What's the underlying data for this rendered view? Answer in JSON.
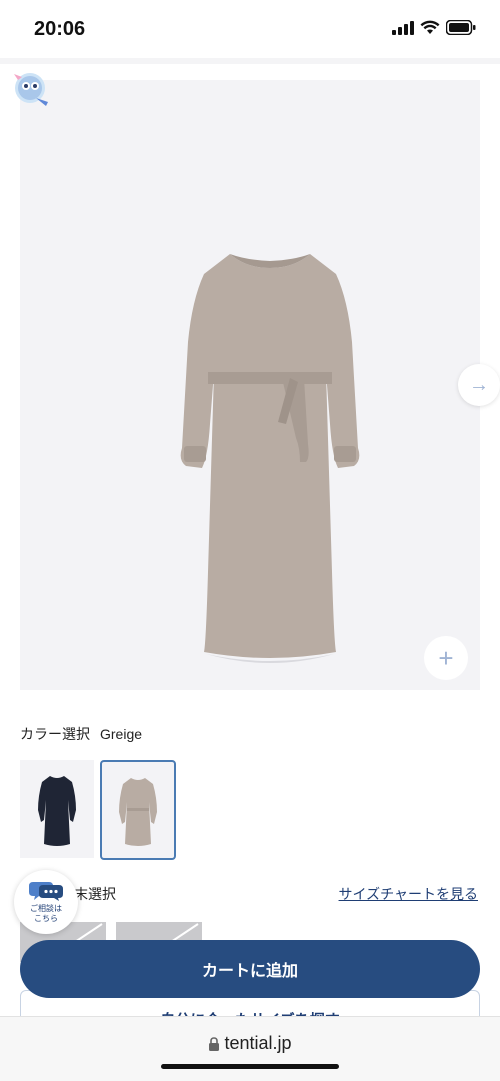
{
  "status_bar": {
    "time": "20:06"
  },
  "product": {
    "color_heading": "カラー選択",
    "color_value": "Greige",
    "swatches": [
      {
        "name": "Navy",
        "color": "#1f2535"
      },
      {
        "name": "Greige",
        "color": "#b8aca3",
        "selected": true
      }
    ]
  },
  "size": {
    "heading": "サイズ選択",
    "heading_visible": "末選択",
    "chart_link": "サイズチャートを見る"
  },
  "consult": {
    "label_line1": "ご相談は",
    "label_line2": "こちら"
  },
  "actions": {
    "add_to_cart": "カートに追加",
    "find_size": "自分に合ったサイズを探す"
  },
  "browser": {
    "url": "tential.jp"
  },
  "colors": {
    "accent": "#274c80",
    "link": "#1f3e74",
    "selected_border": "#4a7bb3"
  }
}
